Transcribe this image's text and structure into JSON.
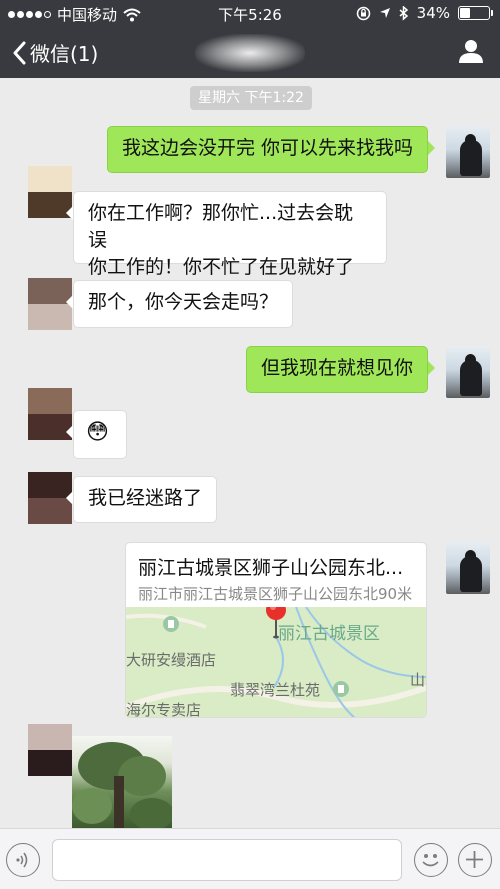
{
  "status_bar": {
    "carrier": "中国移动",
    "time": "下午5:26",
    "battery": "34%",
    "battery_level": 0.34
  },
  "nav": {
    "back_label": "微信(1)"
  },
  "chat": {
    "timestamp": "星期六 下午1:22",
    "messages": [
      {
        "side": "me",
        "text": "我这边会没开完 你可以先来找我吗"
      },
      {
        "side": "them",
        "line1": "你在工作啊？那你忙...过去会耽误",
        "line2": "你工作的！你不忙了在见就好了"
      },
      {
        "side": "them",
        "text": "那个，你今天会走吗？"
      },
      {
        "side": "me",
        "text": "但我现在就想见你"
      },
      {
        "side": "them",
        "emoji": "😳"
      },
      {
        "side": "them",
        "text": "我已经迷路了"
      }
    ],
    "location": {
      "title": "丽江古城景区狮子山公园东北...",
      "address": "丽江市丽江古城景区狮子山公园东北90米",
      "map_labels": {
        "scenic": "丽江古城景区",
        "hotel": "大研安缦酒店",
        "garden": "翡翠湾兰杜苑",
        "store": "海尔专卖店",
        "mountain": "山水"
      }
    }
  },
  "input_bar": {
    "placeholder": ""
  },
  "colors": {
    "nav_bg": "#393a3f",
    "chat_bg": "#ebebeb",
    "my_bubble": "#9fe658",
    "their_bubble": "#ffffff",
    "pin": "#e8302a"
  }
}
